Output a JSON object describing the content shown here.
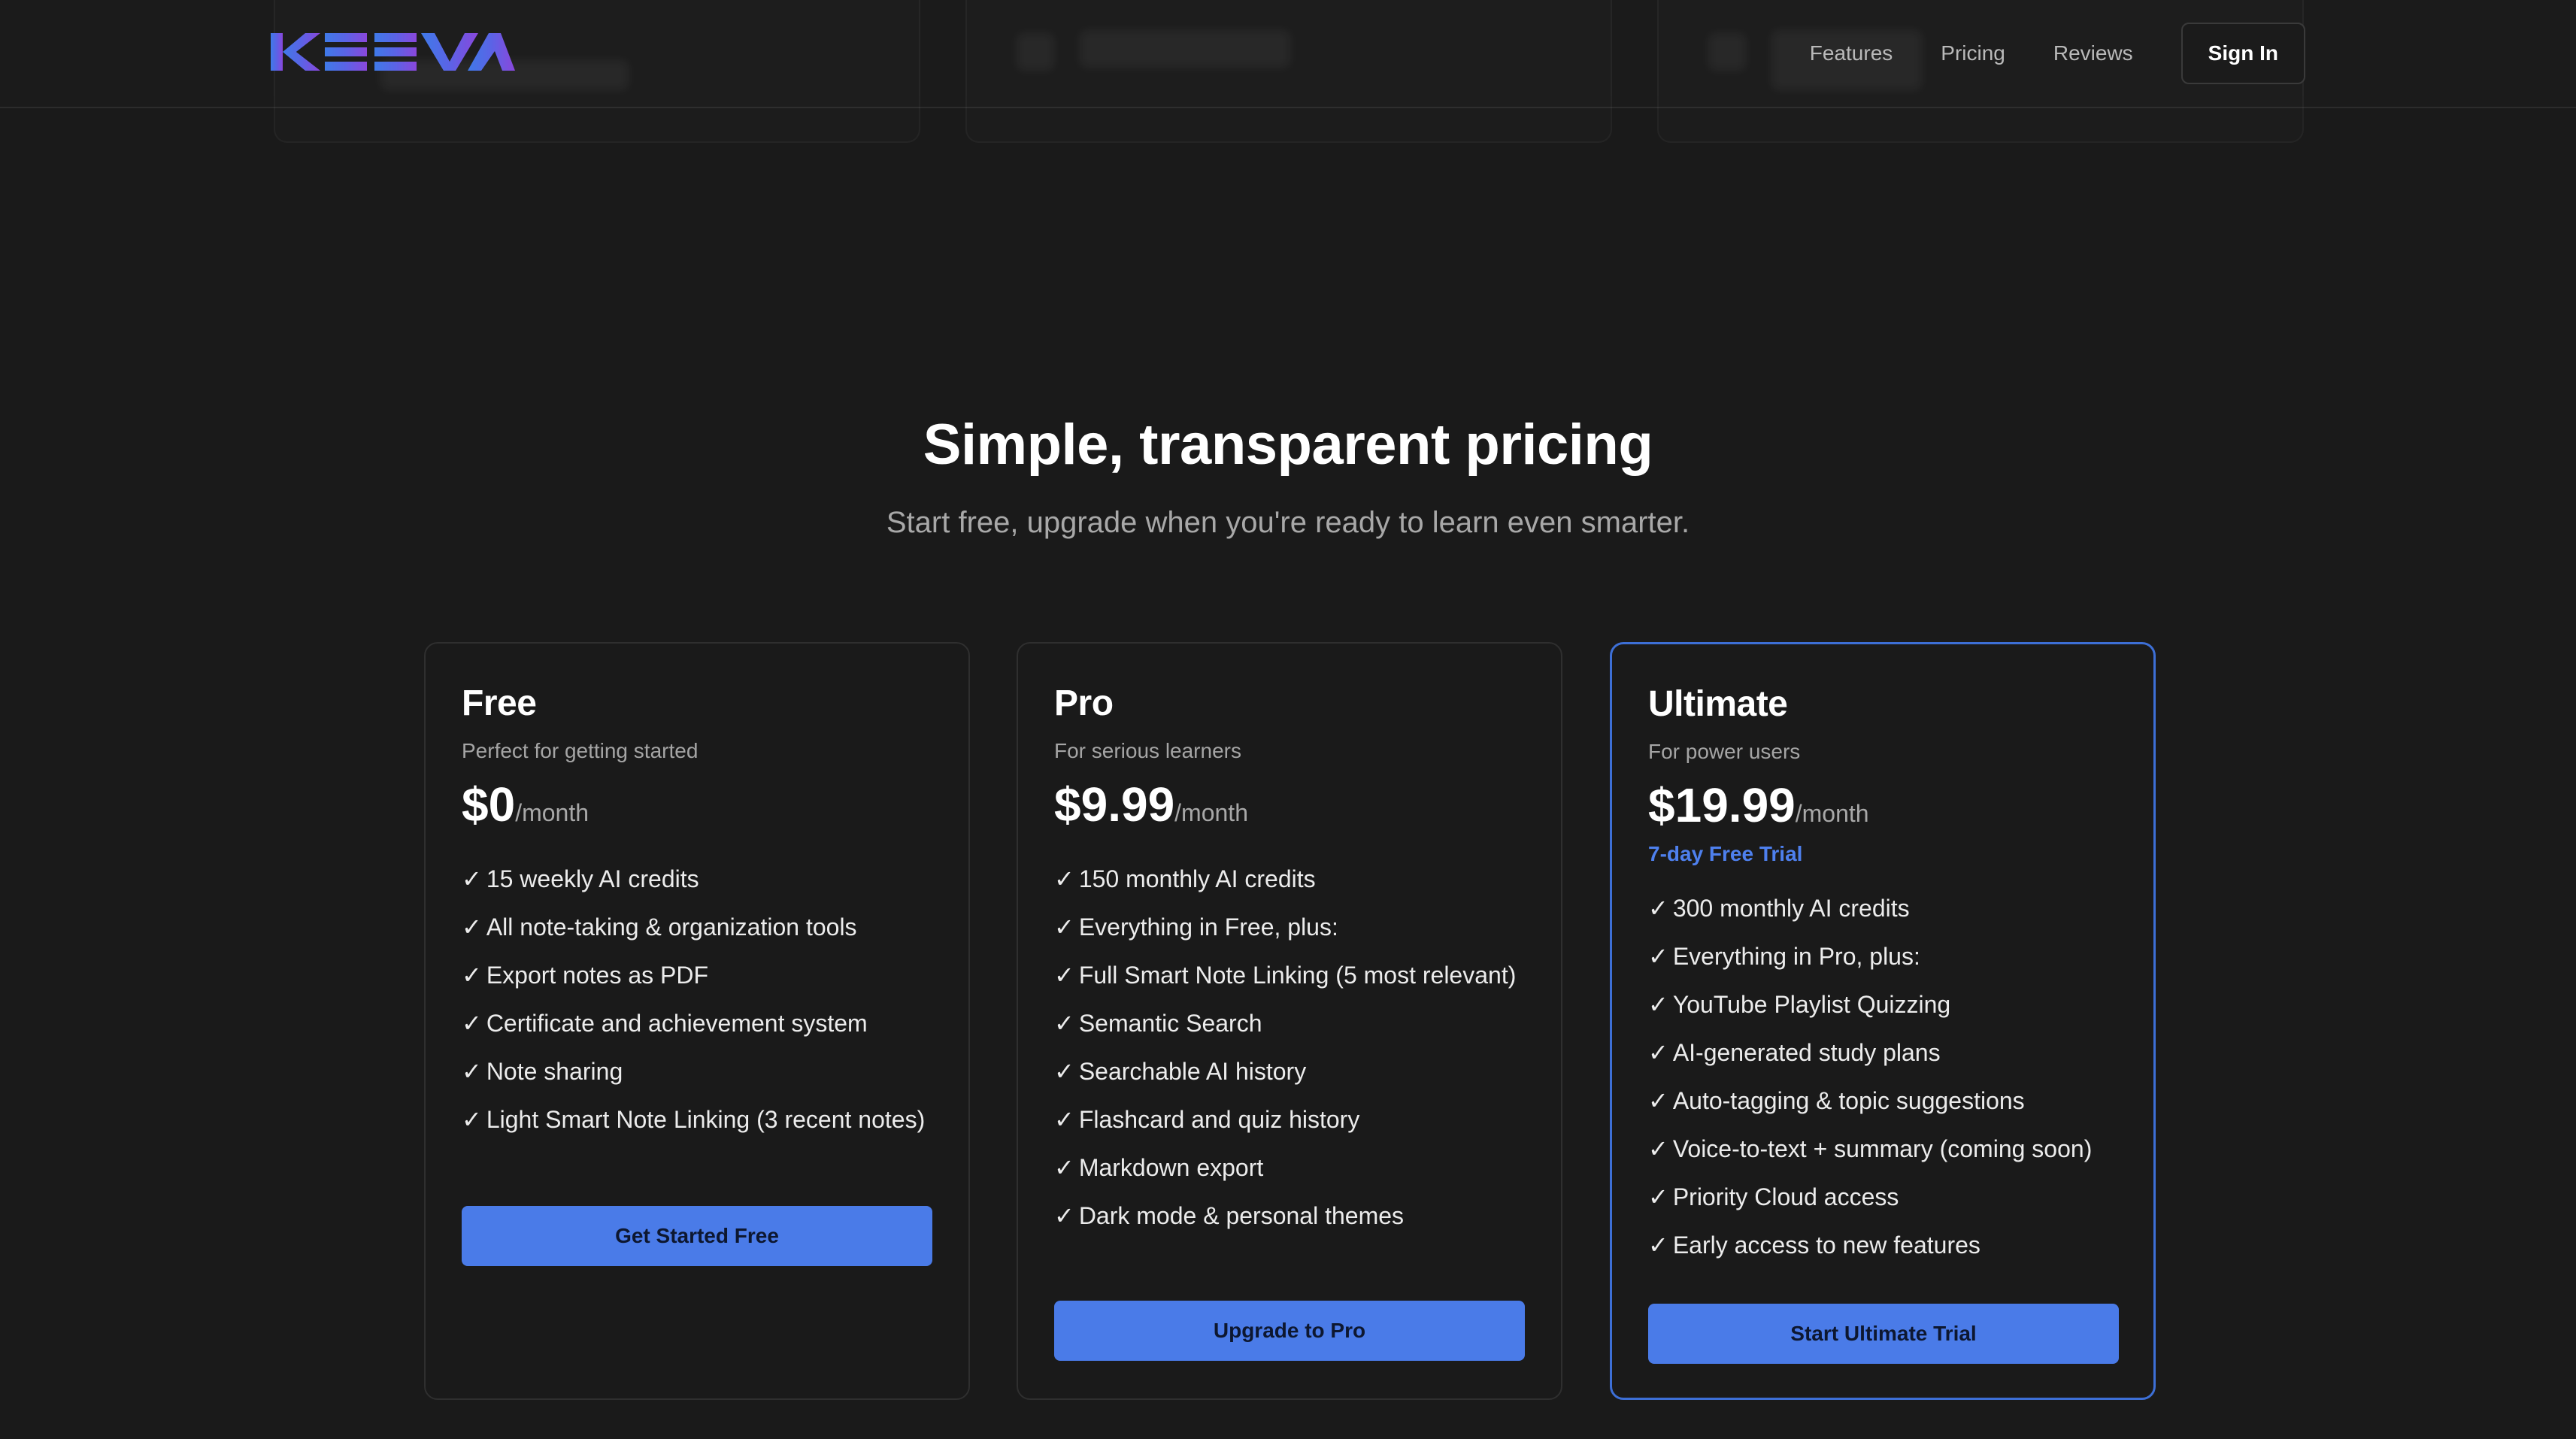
{
  "header": {
    "logo_text": "KEEVA",
    "nav": [
      {
        "label": "Features"
      },
      {
        "label": "Pricing"
      },
      {
        "label": "Reviews"
      }
    ],
    "sign_in_label": "Sign In"
  },
  "hero": {
    "title": "Simple, transparent pricing",
    "subtitle": "Start free, upgrade when you're ready to learn even smarter."
  },
  "check_glyph": "✓",
  "plans": [
    {
      "name": "Free",
      "tagline": "Perfect for getting started",
      "price": "$0",
      "period": "/month",
      "features": [
        "15 weekly AI credits",
        "All note-taking & organization tools",
        "Export notes as PDF",
        "Certificate and achievement system",
        "Note sharing",
        "Light Smart Note Linking (3 recent notes)"
      ],
      "cta": "Get Started Free"
    },
    {
      "name": "Pro",
      "tagline": "For serious learners",
      "price": "$9.99",
      "period": "/month",
      "features": [
        "150 monthly AI credits",
        "Everything in Free, plus:",
        "Full Smart Note Linking (5 most relevant)",
        "Semantic Search",
        "Searchable AI history",
        "Flashcard and quiz history",
        "Markdown export",
        "Dark mode & personal themes"
      ],
      "cta": "Upgrade to Pro"
    },
    {
      "name": "Ultimate",
      "tagline": "For power users",
      "price": "$19.99",
      "period": "/month",
      "trial": "7-day Free Trial",
      "features": [
        "300 monthly AI credits",
        "Everything in Pro, plus:",
        "YouTube Playlist Quizzing",
        "AI-generated study plans",
        "Auto-tagging & topic suggestions",
        "Voice-to-text + summary (coming soon)",
        "Priority Cloud access",
        "Early access to new features"
      ],
      "cta": "Start Ultimate Trial"
    }
  ],
  "colors": {
    "background": "#1a1a1a",
    "accent": "#4a7be8",
    "trial_text": "#4e80ee",
    "highlight_border": "#3d6fd6"
  }
}
